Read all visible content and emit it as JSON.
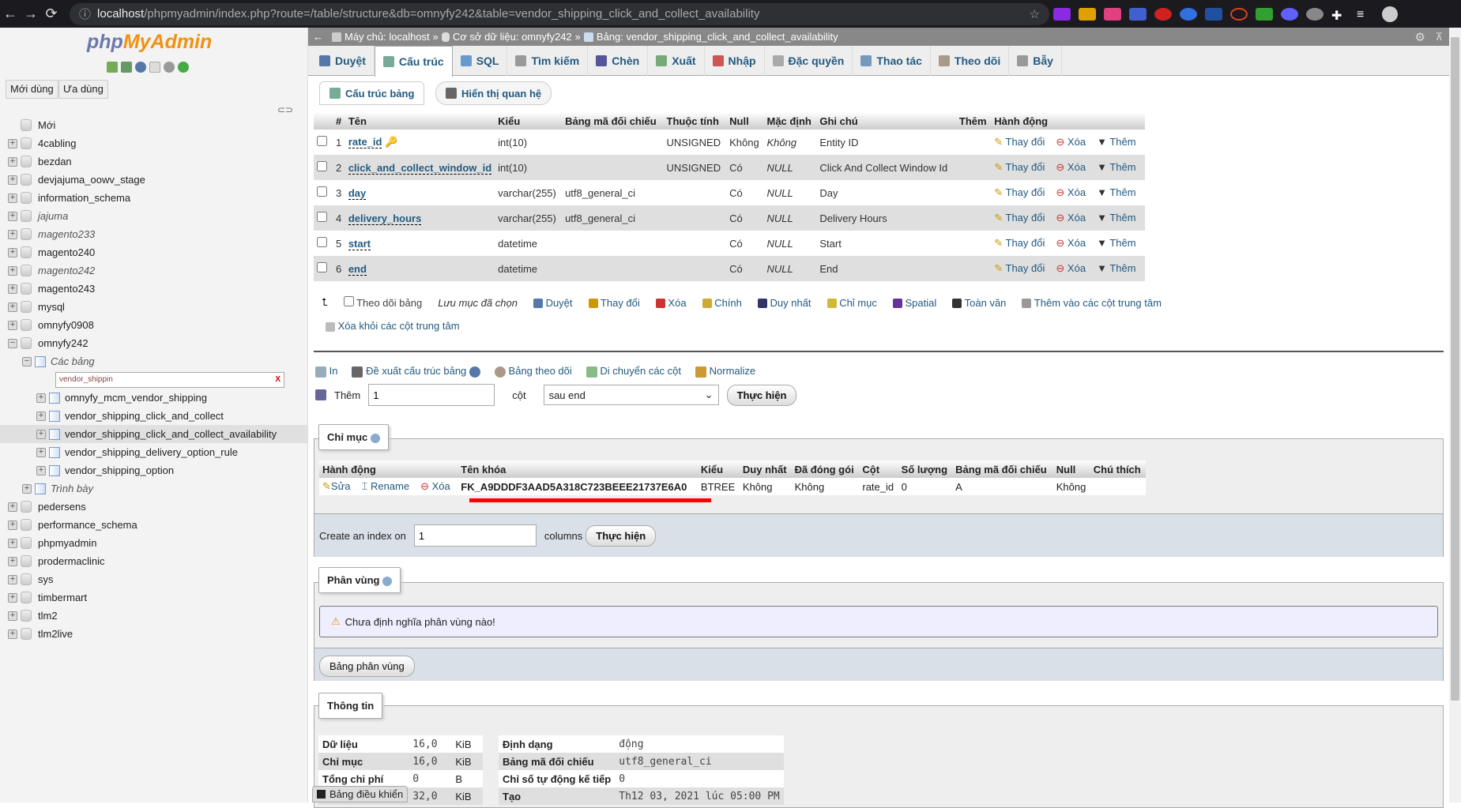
{
  "browser": {
    "url_host": "localhost",
    "url_path": "/phpmyadmin/index.php?route=/table/structure&db=omnyfy242&table=vendor_shipping_click_and_collect_availability"
  },
  "sidebar": {
    "logo_php": "php",
    "logo_myadmin": "MyAdmin",
    "recent": "Mới dùng",
    "favorites": "Ưa dùng",
    "tree": [
      {
        "name": "Mới"
      },
      {
        "name": "4cabling"
      },
      {
        "name": "bezdan"
      },
      {
        "name": "devjajuma_oowv_stage"
      },
      {
        "name": "information_schema"
      },
      {
        "name": "jajuma",
        "italic": true
      },
      {
        "name": "magento233",
        "italic": true
      },
      {
        "name": "magento240"
      },
      {
        "name": "magento242",
        "italic": true
      },
      {
        "name": "magento243"
      },
      {
        "name": "mysql"
      },
      {
        "name": "omnyfy0908"
      },
      {
        "name": "omnyfy242",
        "expanded": true
      }
    ],
    "tables_label": "Các bảng",
    "filter_value": "vendor_shippin",
    "filter_clear": "X",
    "tables": [
      "omnyfy_mcm_vendor_shipping",
      "vendor_shipping_click_and_collect",
      "vendor_shipping_click_and_collect_availability",
      "vendor_shipping_delivery_option_rule",
      "vendor_shipping_option"
    ],
    "views_label": "Trình bày",
    "tree_after": [
      "pedersens",
      "performance_schema",
      "phpmyadmin",
      "prodermaclinic",
      "sys",
      "timbermart",
      "tlm2",
      "tlm2live"
    ]
  },
  "breadcrumb": {
    "server": "Máy chủ: localhost",
    "db": "Cơ sở dữ liệu: omnyfy242",
    "table": "Bảng: vendor_shipping_click_and_collect_availability"
  },
  "tabs": [
    "Duyệt",
    "Cấu trúc",
    "SQL",
    "Tìm kiếm",
    "Chèn",
    "Xuất",
    "Nhập",
    "Đặc quyền",
    "Thao tác",
    "Theo dõi",
    "Bẫy"
  ],
  "active_tab": "Cấu trúc",
  "subtabs": [
    "Cấu trúc bảng",
    "Hiển thị quan hệ"
  ],
  "structure": {
    "headers": [
      "#",
      "Tên",
      "Kiểu",
      "Bảng mã đối chiếu",
      "Thuộc tính",
      "Null",
      "Mặc định",
      "Ghi chú",
      "Thêm",
      "Hành động"
    ],
    "rows": [
      {
        "n": "1",
        "name": "rate_id",
        "type": "int(10)",
        "collation": "",
        "attr": "UNSIGNED",
        "null": "Không",
        "default": "Không",
        "comment": "Entity ID",
        "extra": "",
        "primary": true
      },
      {
        "n": "2",
        "name": "click_and_collect_window_id",
        "type": "int(10)",
        "collation": "",
        "attr": "UNSIGNED",
        "null": "Có",
        "default": "NULL",
        "comment": "Click And Collect Window Id",
        "extra": ""
      },
      {
        "n": "3",
        "name": "day",
        "type": "varchar(255)",
        "collation": "utf8_general_ci",
        "attr": "",
        "null": "Có",
        "default": "NULL",
        "comment": "Day",
        "extra": ""
      },
      {
        "n": "4",
        "name": "delivery_hours",
        "type": "varchar(255)",
        "collation": "utf8_general_ci",
        "attr": "",
        "null": "Có",
        "default": "NULL",
        "comment": "Delivery Hours",
        "extra": ""
      },
      {
        "n": "5",
        "name": "start",
        "type": "datetime",
        "collation": "",
        "attr": "",
        "null": "Có",
        "default": "NULL",
        "comment": "Start",
        "extra": ""
      },
      {
        "n": "6",
        "name": "end",
        "type": "datetime",
        "collation": "",
        "attr": "",
        "null": "Có",
        "default": "NULL",
        "comment": "End",
        "extra": ""
      }
    ],
    "row_actions": {
      "change": "Thay đổi",
      "drop": "Xóa",
      "more": "Thêm"
    }
  },
  "bulk": {
    "check_all": "Theo dõi bảng",
    "with_selected": "Lưu mục đã chọn",
    "actions": [
      "Duyệt",
      "Thay đổi",
      "Xóa",
      "Chính",
      "Duy nhất",
      "Chỉ mục",
      "Spatial",
      "Toàn văn",
      "Thêm vào các cột trung tâm"
    ],
    "remove_central": "Xóa khỏi các cột trung tâm"
  },
  "tools": {
    "print": "In",
    "propose": "Đề xuất cấu trúc bảng",
    "track": "Bảng theo dõi",
    "move": "Di chuyển các cột",
    "normalize": "Normalize"
  },
  "add_column": {
    "label": "Thêm",
    "count": "1",
    "unit": "cột",
    "position": "sau end",
    "go": "Thực hiện"
  },
  "indexes": {
    "legend": "Chỉ mục",
    "headers": [
      "Hành động",
      "Tên khóa",
      "Kiểu",
      "Duy nhất",
      "Đã đóng gói",
      "Cột",
      "Số lượng",
      "Bảng mã đối chiếu",
      "Null",
      "Chú thích"
    ],
    "row": {
      "edit": "Sửa",
      "rename": "Rename",
      "drop": "Xóa",
      "key": "FK_A9DDDF3AAD5A318C723BEEE21737E6A0",
      "type": "BTREE",
      "unique": "Không",
      "packed": "Không",
      "column": "rate_id",
      "cardinality": "0",
      "collation": "A",
      "null": "Không",
      "comment": ""
    },
    "highlight_color": "#ff0000",
    "create_label": "Create an index on",
    "create_count": "1",
    "create_unit": "columns",
    "go": "Thực hiện"
  },
  "partitions": {
    "legend": "Phân vùng",
    "notice": "Chưa định nghĩa phân vùng nào!",
    "button": "Bảng phân vùng"
  },
  "info": {
    "legend": "Thông tin",
    "space": [
      {
        "k": "Dữ liệu",
        "v": "16,0",
        "u": "KiB"
      },
      {
        "k": "Chỉ mục",
        "v": "16,0",
        "u": "KiB"
      },
      {
        "k": "Tổng chi phí",
        "v": "0",
        "u": "B"
      },
      {
        "k": "",
        "v": "32,0",
        "u": "KiB"
      }
    ],
    "stats": [
      {
        "k": "Định dạng",
        "v": "động"
      },
      {
        "k": "Bảng mã đối chiếu",
        "v": "utf8_general_ci"
      },
      {
        "k": "Chỉ số tự động kế tiếp",
        "v": "0"
      },
      {
        "k": "Tạo",
        "v": "Th12 03, 2021 lúc 05:00 PM"
      }
    ]
  },
  "console": {
    "label": "Bảng điều khiển"
  }
}
